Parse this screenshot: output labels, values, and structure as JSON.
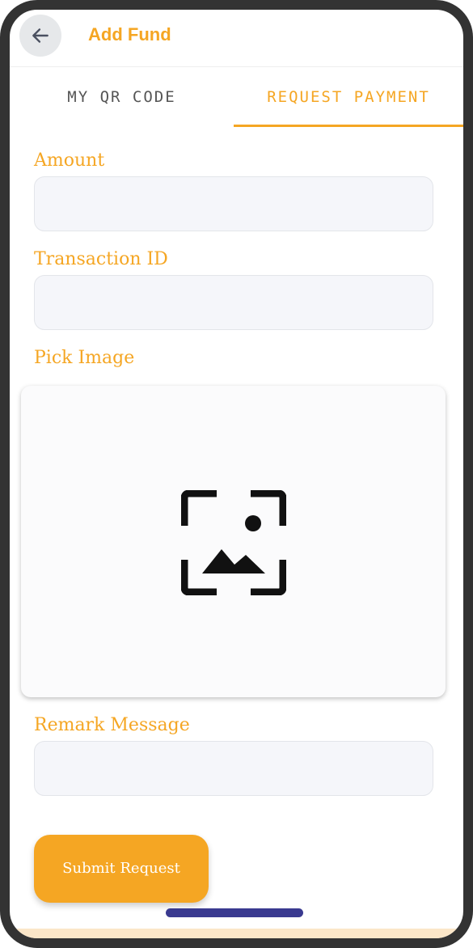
{
  "header": {
    "title": "Add Fund",
    "back_icon": "arrow-left-icon"
  },
  "tabs": [
    {
      "label": "MY QR CODE",
      "active": false
    },
    {
      "label": "REQUEST PAYMENT",
      "active": true
    }
  ],
  "form": {
    "amount_label": "Amount",
    "amount_value": "",
    "transaction_label": "Transaction ID",
    "transaction_value": "",
    "pick_image_label": "Pick Image",
    "image_icon": "image-placeholder-icon",
    "remark_label": "Remark Message",
    "remark_value": "",
    "submit_label": "Submit Request"
  },
  "colors": {
    "accent": "#f5a623",
    "field_bg": "#f5f6fa",
    "frame": "#333333",
    "home_indicator": "#3a3a90"
  }
}
